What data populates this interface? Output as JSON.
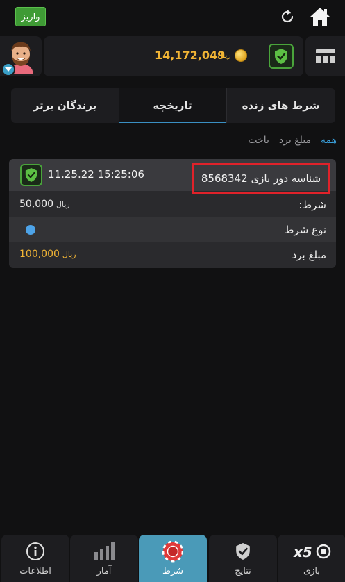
{
  "topbar": {
    "deposit_label": "واریز"
  },
  "header": {
    "balance_value": "14,172,049",
    "balance_currency": "ریال"
  },
  "tabs": [
    {
      "label": "شرط های زنده",
      "active": false
    },
    {
      "label": "تاریخچه",
      "active": true
    },
    {
      "label": "برندگان برتر",
      "active": false
    }
  ],
  "filters": [
    {
      "label": "همه",
      "active": true
    },
    {
      "label": "مبلغ برد",
      "active": false
    },
    {
      "label": "باخت",
      "active": false
    }
  ],
  "bet_card": {
    "round_id_label": "شناسه دور بازی 8568342",
    "time": "11.25.22 15:25:06",
    "bet_label": ":شرط",
    "bet_value": "50,000",
    "bet_currency": "ریال",
    "bet_type_label": "نوع شرط",
    "win_label": "مبلغ برد",
    "win_value": "100,000",
    "win_currency": "ریال"
  },
  "bottom_nav": [
    {
      "label": "اطلاعات",
      "icon": "info-icon",
      "active": false
    },
    {
      "label": "آمار",
      "icon": "stats-icon",
      "active": false
    },
    {
      "label": "شرط",
      "icon": "chip-icon",
      "active": true
    },
    {
      "label": "نتایج",
      "icon": "shield-check-icon",
      "active": false
    },
    {
      "label": "بازی",
      "icon": "x50-logo-icon",
      "active": false
    }
  ],
  "colors": {
    "accent_blue": "#3aa0dc",
    "gold": "#f2b535",
    "green": "#4aa43b",
    "highlight_red": "#e0222a"
  }
}
